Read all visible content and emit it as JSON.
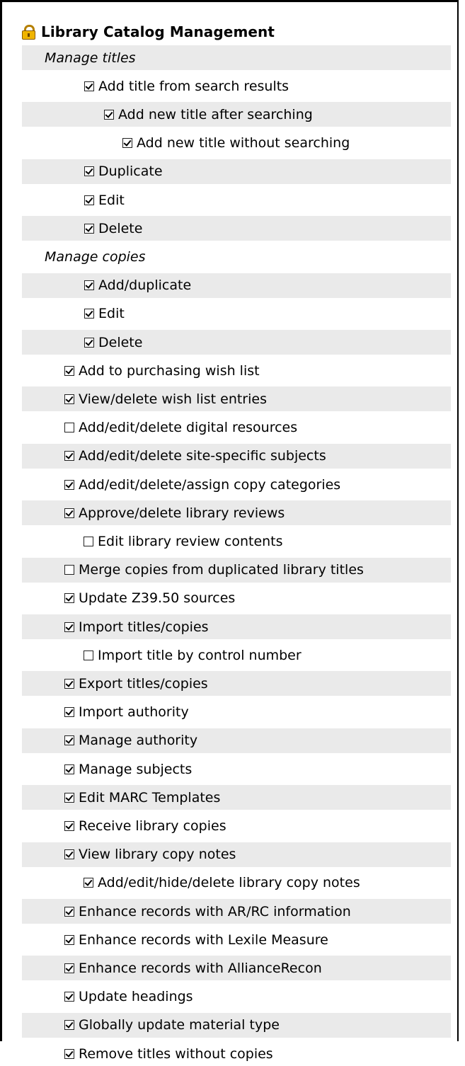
{
  "header": {
    "title": "Library Catalog Management",
    "icon": "lock-icon"
  },
  "rows": [
    {
      "label": "Manage titles",
      "level": 0,
      "section": true,
      "shade": true
    },
    {
      "label": "Add title from search results",
      "level": 2,
      "checked": true,
      "shade": false
    },
    {
      "label": "Add new title after searching",
      "level": 3,
      "checked": true,
      "shade": true
    },
    {
      "label": "Add new title without searching",
      "level": 4,
      "checked": true,
      "shade": false
    },
    {
      "label": "Duplicate",
      "level": 2,
      "checked": true,
      "shade": true
    },
    {
      "label": "Edit",
      "level": 2,
      "checked": true,
      "shade": false
    },
    {
      "label": "Delete",
      "level": 2,
      "checked": true,
      "shade": true
    },
    {
      "label": "Manage copies",
      "level": 0,
      "section": true,
      "shade": false
    },
    {
      "label": "Add/duplicate",
      "level": 2,
      "checked": true,
      "shade": true
    },
    {
      "label": "Edit",
      "level": 2,
      "checked": true,
      "shade": false
    },
    {
      "label": "Delete",
      "level": 2,
      "checked": true,
      "shade": true
    },
    {
      "label": "Add to purchasing wish list",
      "level": 1,
      "checked": true,
      "shade": false
    },
    {
      "label": "View/delete wish list entries",
      "level": 1,
      "checked": true,
      "shade": true
    },
    {
      "label": "Add/edit/delete digital resources",
      "level": 1,
      "checked": false,
      "shade": false
    },
    {
      "label": "Add/edit/delete site-specific subjects",
      "level": 1,
      "checked": true,
      "shade": true
    },
    {
      "label": "Add/edit/delete/assign copy categories",
      "level": 1,
      "checked": true,
      "shade": false
    },
    {
      "label": "Approve/delete library reviews",
      "level": 1,
      "checked": true,
      "shade": true
    },
    {
      "label": "Edit library review contents",
      "level": 1.5,
      "checked": false,
      "shade": false
    },
    {
      "label": "Merge copies from duplicated library titles",
      "level": 1,
      "checked": false,
      "shade": true
    },
    {
      "label": "Update Z39.50 sources",
      "level": 1,
      "checked": true,
      "shade": false
    },
    {
      "label": "Import titles/copies",
      "level": 1,
      "checked": true,
      "shade": true
    },
    {
      "label": "Import title by control number",
      "level": 1.5,
      "checked": false,
      "shade": false
    },
    {
      "label": "Export titles/copies",
      "level": 1,
      "checked": true,
      "shade": true
    },
    {
      "label": "Import authority",
      "level": 1,
      "checked": true,
      "shade": false
    },
    {
      "label": "Manage authority",
      "level": 1,
      "checked": true,
      "shade": true
    },
    {
      "label": "Manage subjects",
      "level": 1,
      "checked": true,
      "shade": false
    },
    {
      "label": "Edit MARC Templates",
      "level": 1,
      "checked": true,
      "shade": true
    },
    {
      "label": "Receive library copies",
      "level": 1,
      "checked": true,
      "shade": false
    },
    {
      "label": "View library copy notes",
      "level": 1,
      "checked": true,
      "shade": true
    },
    {
      "label": "Add/edit/hide/delete library copy notes",
      "level": 1.5,
      "checked": true,
      "shade": false
    },
    {
      "label": "Enhance records with AR/RC information",
      "level": 1,
      "checked": true,
      "shade": true
    },
    {
      "label": "Enhance records with Lexile Measure",
      "level": 1,
      "checked": true,
      "shade": false
    },
    {
      "label": "Enhance records with AllianceRecon",
      "level": 1,
      "checked": true,
      "shade": true
    },
    {
      "label": "Update headings",
      "level": 1,
      "checked": true,
      "shade": false
    },
    {
      "label": "Globally update material type",
      "level": 1,
      "checked": true,
      "shade": true
    },
    {
      "label": "Remove titles without copies",
      "level": 1,
      "checked": true,
      "shade": false
    }
  ]
}
